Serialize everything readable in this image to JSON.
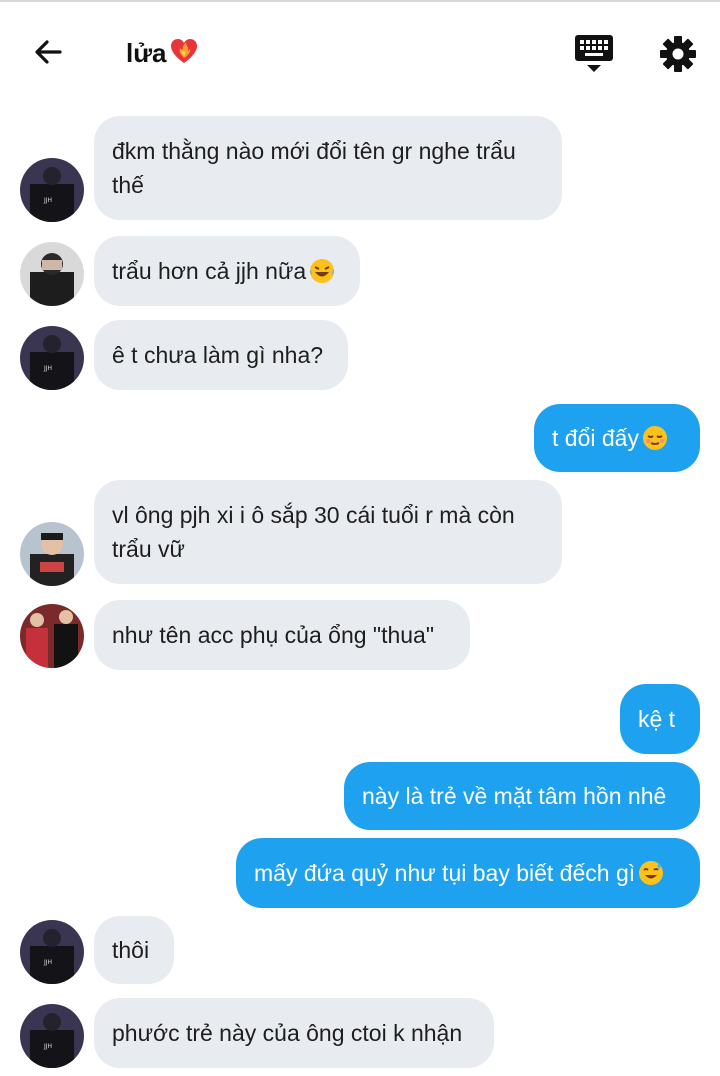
{
  "header": {
    "title": "lửa",
    "back_icon": "arrow-left-icon",
    "keyboard_icon": "keyboard-icon",
    "settings_icon": "gear-icon"
  },
  "colors": {
    "incoming_bubble": "#e8ebef",
    "outgoing_bubble": "#1ea2ef"
  },
  "messages": [
    {
      "side": "in",
      "line1": "đkm thằng nào mới đổi tên gr nghe trẩu",
      "line2": "thế"
    },
    {
      "side": "in",
      "text": "trẩu hơn cả jjh nữa",
      "emoji": "laughing-tears-emoji"
    },
    {
      "side": "in",
      "text": "ê t chưa làm gì nha?"
    },
    {
      "side": "out",
      "text": "t đổi đấy",
      "emoji": "relieved-face-emoji"
    },
    {
      "side": "in",
      "line1": "vl ông pjh xi i ô sắp 30 cái tuổi r mà còn",
      "line2": "trẩu vữ"
    },
    {
      "side": "in",
      "text": "như tên acc phụ của ổng \"thua\""
    },
    {
      "side": "out",
      "text": "kệ t"
    },
    {
      "side": "out",
      "text": "này là trẻ về mặt tâm hồn nhê"
    },
    {
      "side": "out",
      "text": "mấy đứa quỷ như tụi bay biết đếch gì",
      "emoji": "sweat-smile-emoji"
    },
    {
      "side": "in",
      "text": "thôi"
    },
    {
      "side": "in",
      "text": "phước trẻ này của ông ctoi k nhận"
    }
  ]
}
